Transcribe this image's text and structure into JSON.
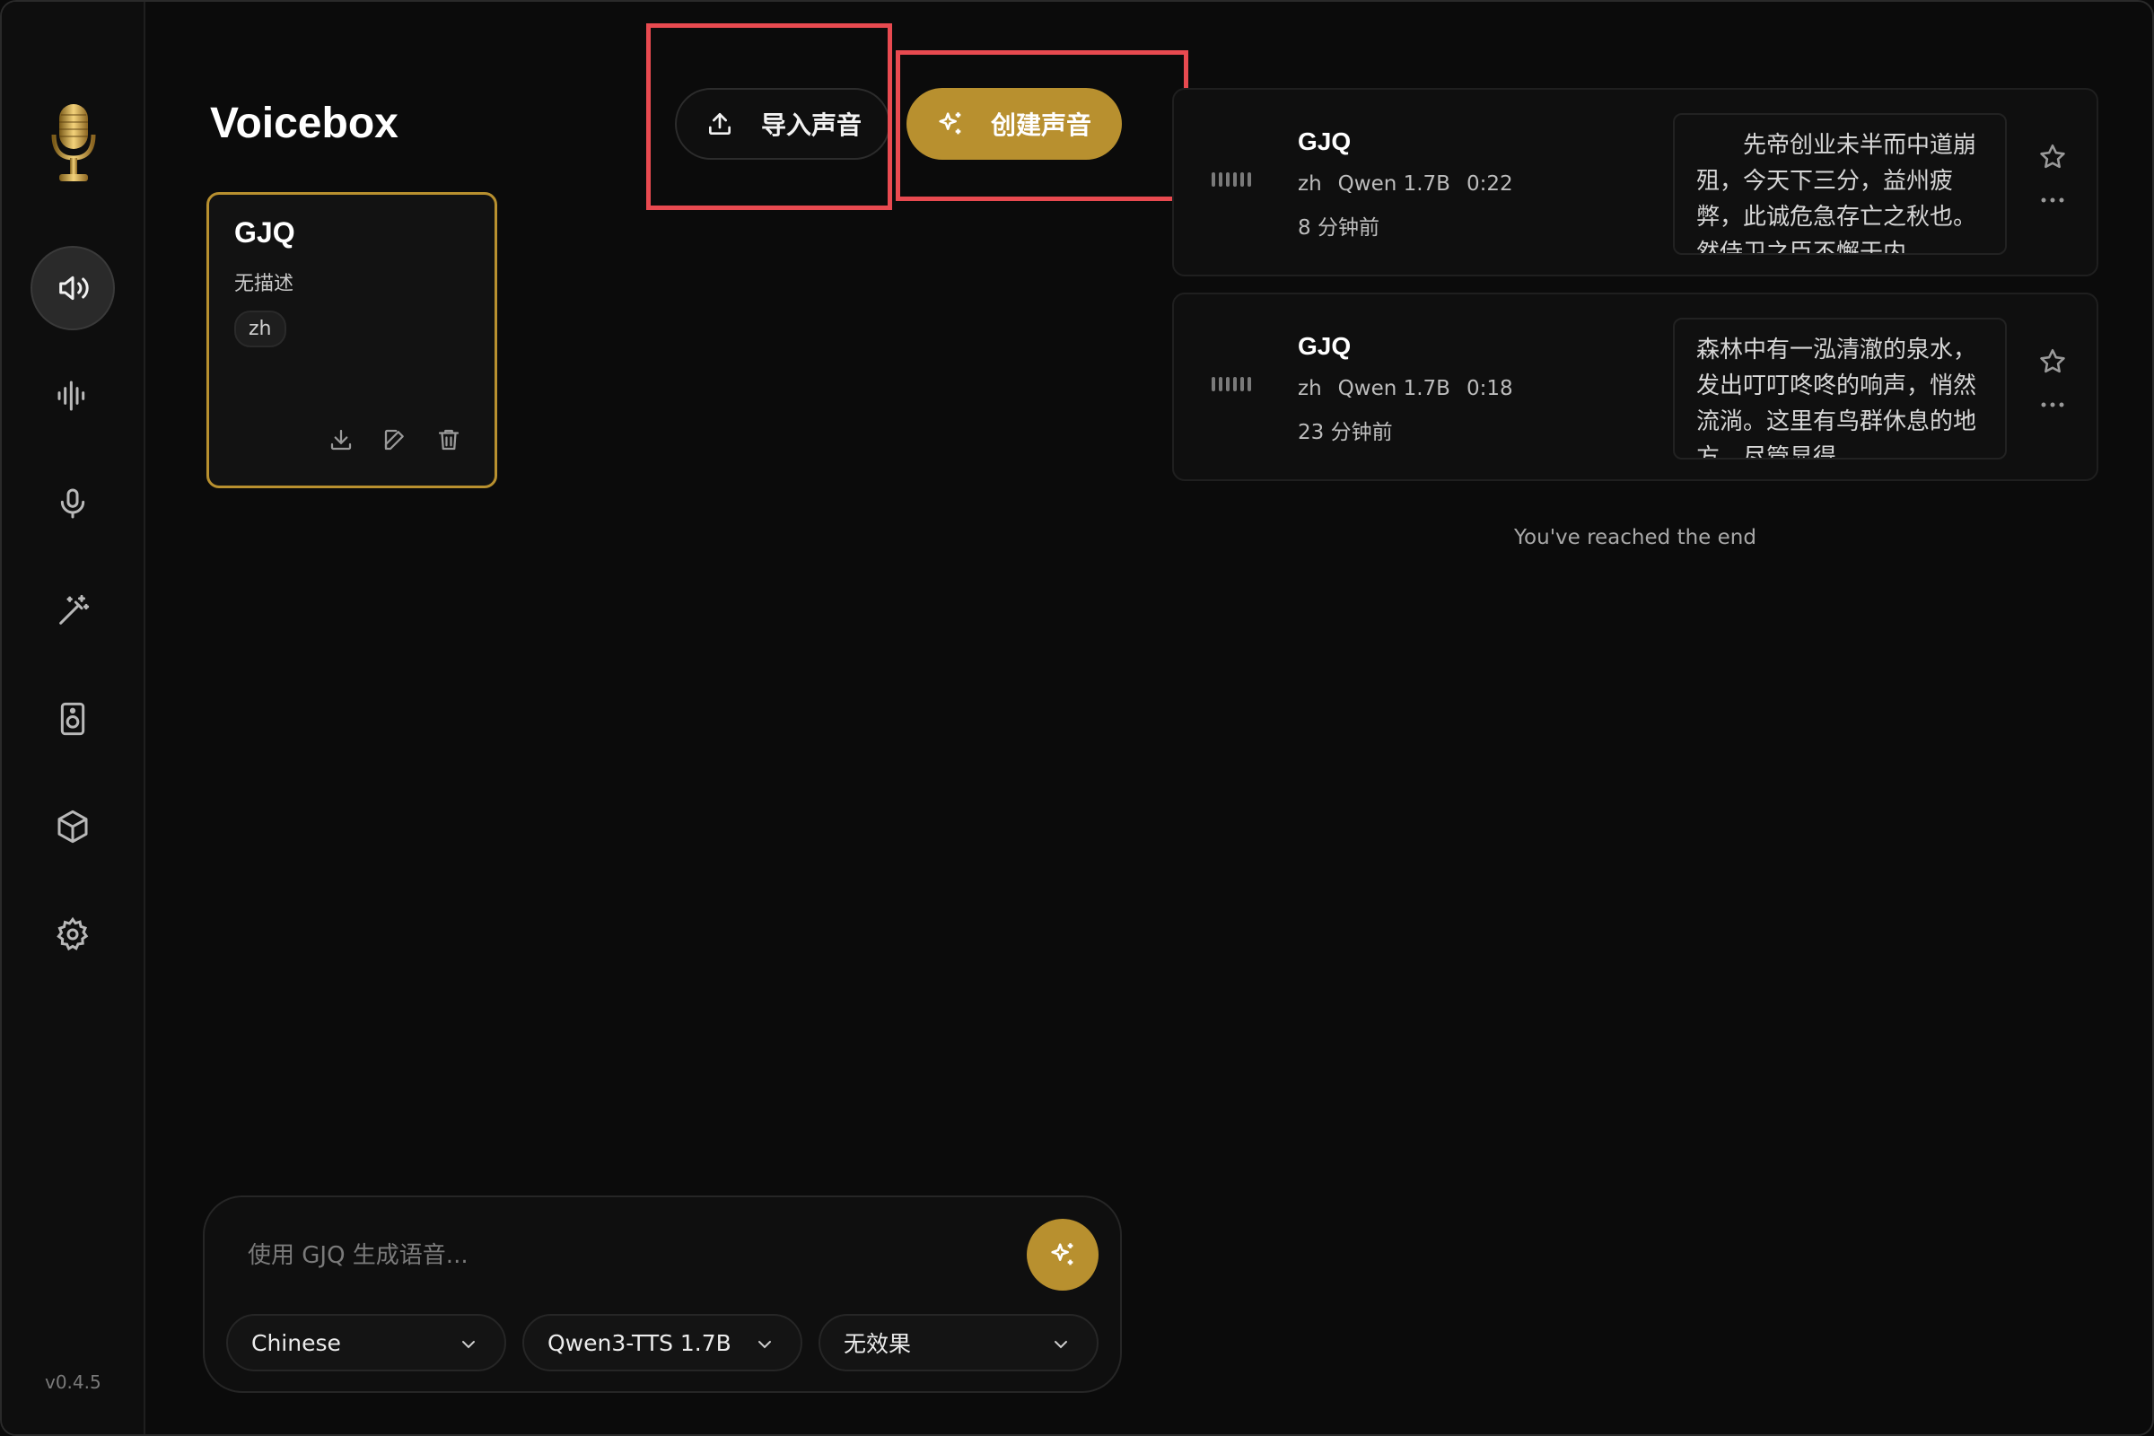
{
  "app": {
    "title": "Voicebox",
    "version": "v0.4.5"
  },
  "sidebar": {
    "items": [
      {
        "name": "voices",
        "icon": "speaker-icon",
        "active": true
      },
      {
        "name": "audio",
        "icon": "waveform-icon"
      },
      {
        "name": "record",
        "icon": "microphone-icon"
      },
      {
        "name": "effects",
        "icon": "magic-wand-icon"
      },
      {
        "name": "speakers",
        "icon": "speaker-box-icon"
      },
      {
        "name": "models",
        "icon": "cube-icon"
      },
      {
        "name": "settings",
        "icon": "gear-icon"
      }
    ]
  },
  "toolbar": {
    "import_label": "导入声音",
    "create_label": "创建声音"
  },
  "voice_card": {
    "name": "GJQ",
    "description": "无描述",
    "language": "zh"
  },
  "history": [
    {
      "name": "GJQ",
      "lang": "zh",
      "model": "Qwen 1.7B",
      "duration": "0:22",
      "time": "8 分钟前",
      "text": "　　先帝创业未半而中道崩殂，今天下三分，益州疲弊，此诚危急存亡之秋也。然侍卫之臣不懈于内"
    },
    {
      "name": "GJQ",
      "lang": "zh",
      "model": "Qwen 1.7B",
      "duration": "0:18",
      "time": "23 分钟前",
      "text": "森林中有一泓清澈的泉水，发出叮叮咚咚的响声，悄然流淌。这里有鸟群休息的地方，尽管显得"
    }
  ],
  "end_text": "You've reached the end",
  "generate": {
    "placeholder": "使用 GJQ 生成语音...",
    "language": "Chinese",
    "model": "Qwen3-TTS 1.7B",
    "effect": "无效果"
  },
  "colors": {
    "accent": "#b8902f",
    "highlight": "#e84a50",
    "background": "#0b0b0b"
  }
}
